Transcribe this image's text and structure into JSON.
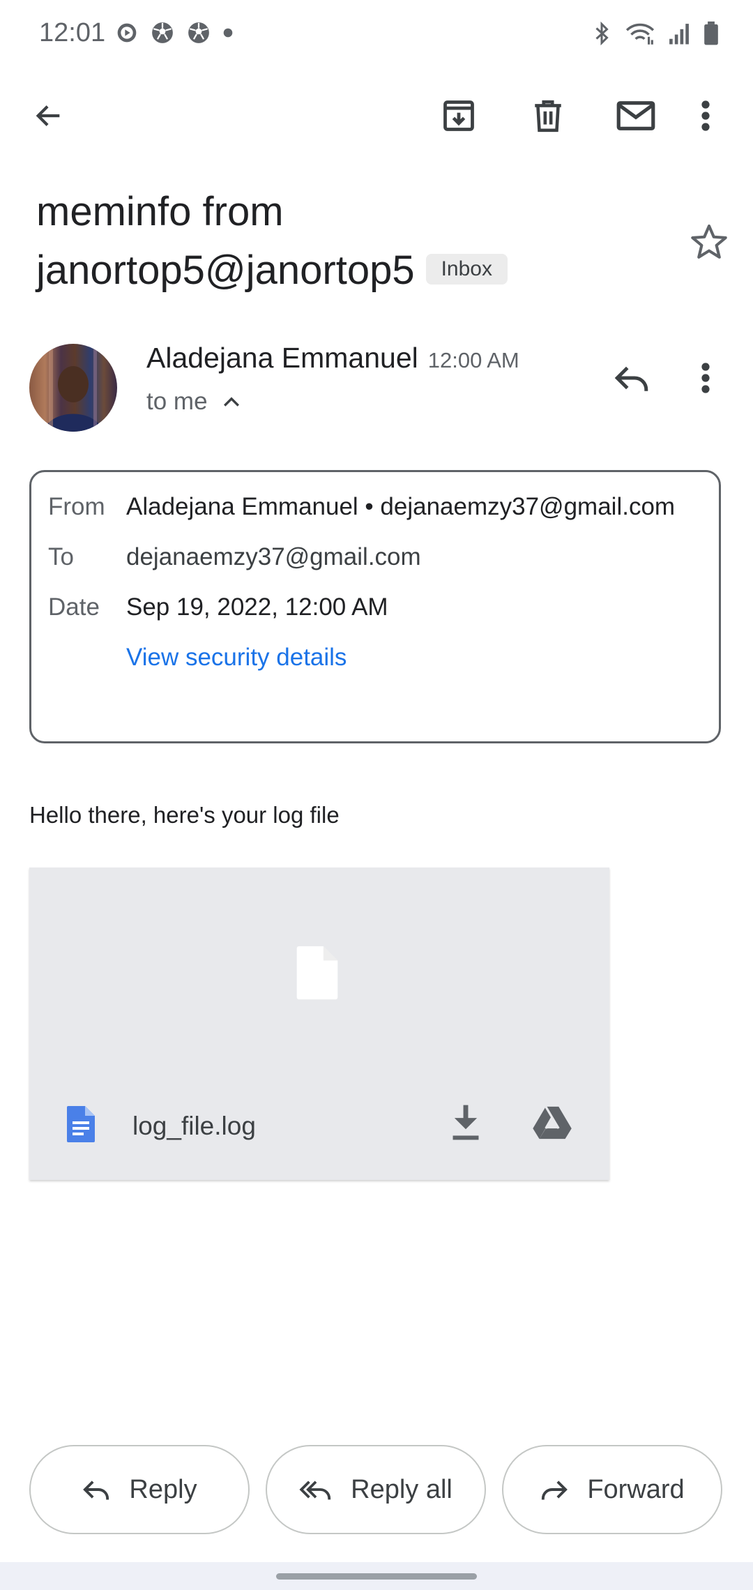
{
  "status_bar": {
    "time": "12:01",
    "left_icons": [
      "media-icon",
      "soccer-ball-icon",
      "soccer-ball-icon",
      "dot-icon"
    ],
    "right_icons": [
      "bluetooth-icon",
      "wifi-icon",
      "signal-icon",
      "battery-icon"
    ]
  },
  "toolbar": {
    "icons": [
      "back-arrow-icon",
      "archive-icon",
      "delete-icon",
      "mark-unread-icon",
      "more-vert-icon"
    ]
  },
  "email": {
    "subject": "meminfo from janortop5@janortop5",
    "label_chip": "Inbox",
    "sender_name": "Aladejana Emmanuel",
    "time": "12:00 AM",
    "recipient_summary": "to me",
    "body": "Hello there, here's your log file"
  },
  "details": {
    "from_label": "From",
    "from_value": "Aladejana Emmanuel • dejanaemzy37@gmail.com",
    "to_label": "To",
    "to_value": "dejanaemzy37@gmail.com",
    "date_label": "Date",
    "date_value": "Sep 19, 2022, 12:00 AM",
    "security_link": "View security details"
  },
  "attachment": {
    "filename": "log_file.log"
  },
  "actions": {
    "reply": "Reply",
    "reply_all": "Reply all",
    "forward": "Forward"
  },
  "colors": {
    "link": "#1a73e8",
    "doc_blue": "#4a80e8",
    "attachment_bg": "#e8e9ec"
  }
}
